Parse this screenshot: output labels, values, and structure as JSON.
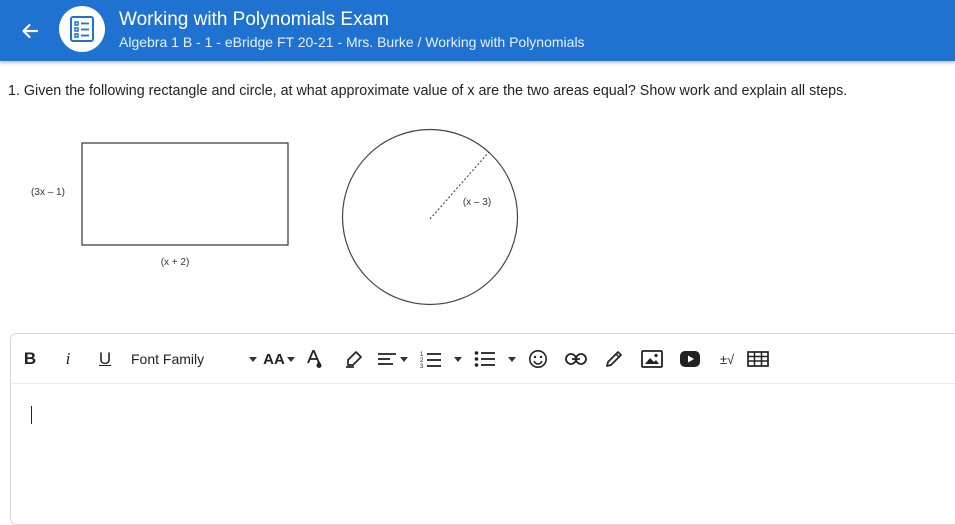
{
  "header": {
    "title": "Working with Polynomials Exam",
    "subtitle": "Algebra 1 B - 1 - eBridge FT 20-21 - Mrs. Burke / Working with Polynomials",
    "back_icon": "arrow-left-icon",
    "app_icon": "checklist-icon",
    "bg_color": "#1f72d0"
  },
  "question": {
    "text": "1. Given the following rectangle and circle, at what approximate value of x are the two areas equal? Show work and explain all steps."
  },
  "figure": {
    "rect_height_label": "(3x – 1)",
    "rect_width_label": "(x + 2)",
    "circle_radius_label": "(x – 3)"
  },
  "toolbar": {
    "bold": "B",
    "italic": "i",
    "underline": "U",
    "font_family": "Font Family",
    "font_size": "AA",
    "special_chars": "±√",
    "icons": [
      "text-color-icon",
      "highlighter-icon",
      "align-icon",
      "ordered-list-icon",
      "bullet-list-icon",
      "emoji-icon",
      "link-icon",
      "draw-icon",
      "image-icon",
      "video-icon",
      "equation-icon",
      "table-icon"
    ]
  }
}
